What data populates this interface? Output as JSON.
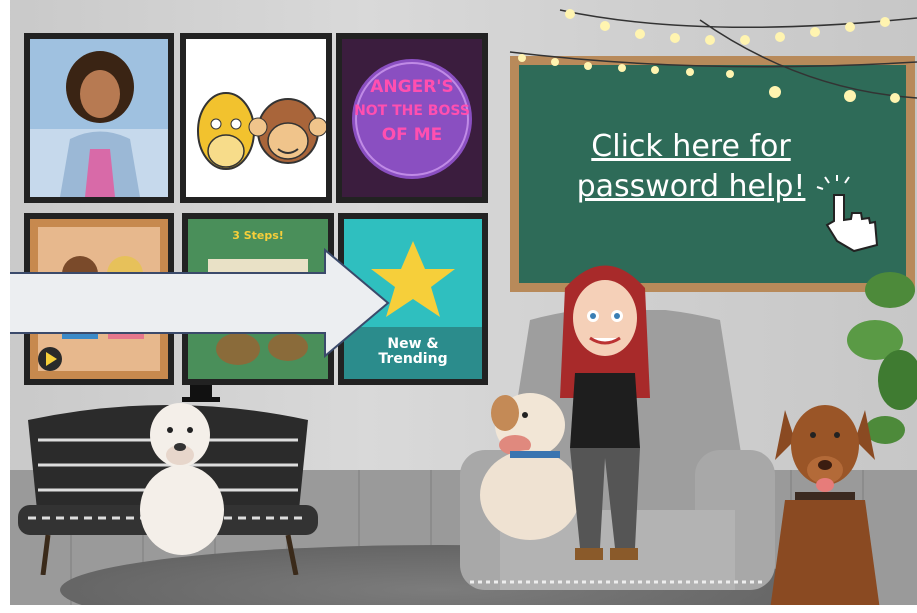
{
  "chalkboard": {
    "link_line1": "Click here for",
    "link_line2": "password help!"
  },
  "tiles": [
    {
      "name": "photo-tile"
    },
    {
      "name": "giraffe-monkey-tile"
    },
    {
      "name": "angers-tile",
      "text_line1": "ANGER'S",
      "text_line2": "NOT THE BOSS",
      "text_line3": "OF ME"
    },
    {
      "name": "story-tile"
    },
    {
      "name": "steps-tile",
      "text": "3 Steps!"
    },
    {
      "name": "new-trending-tile",
      "label_line1": "New &",
      "label_line2": "Trending"
    }
  ],
  "colors": {
    "chalkboard": "#2e6b58",
    "arrow": "#eceef1",
    "arrow_border": "#3b4a6b",
    "trending_bg": "#2fbfbf",
    "star": "#f6cf3a"
  }
}
